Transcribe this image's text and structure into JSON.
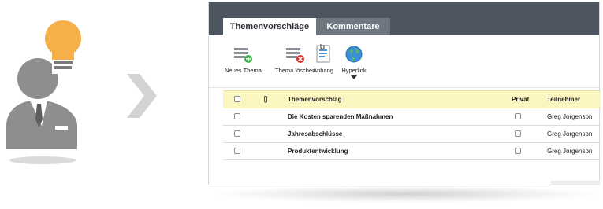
{
  "tabs": [
    {
      "label": "Themenvorschläge",
      "active": true
    },
    {
      "label": "Kommentare",
      "active": false
    }
  ],
  "toolbar": {
    "new_topic": {
      "label": "Neues Thema",
      "icon": "new-topic-icon"
    },
    "delete_topic": {
      "label": "Thema löschen",
      "icon": "delete-topic-icon"
    },
    "attachment": {
      "label": "Anhang",
      "icon": "attachment-icon"
    },
    "hyperlink": {
      "label": "Hyperlink",
      "icon": "globe-icon"
    }
  },
  "table": {
    "headers": {
      "topic": "Themenvorschlag",
      "private": "Privat",
      "participants": "Teilnehmer"
    },
    "rows": [
      {
        "topic": "Die Kosten sparenden Maßnahmen",
        "private": false,
        "participants": "Greg Jorgenson"
      },
      {
        "topic": "Jahresabschlüsse",
        "private": false,
        "participants": "Greg Jorgenson"
      },
      {
        "topic": "Produktentwicklung",
        "private": false,
        "participants": "Greg Jorgenson"
      }
    ]
  },
  "colors": {
    "tabbar": "#4d5560",
    "header_row": "#fbf5c0",
    "person": "#8e8e8e",
    "bulb": "#f5b04a"
  }
}
